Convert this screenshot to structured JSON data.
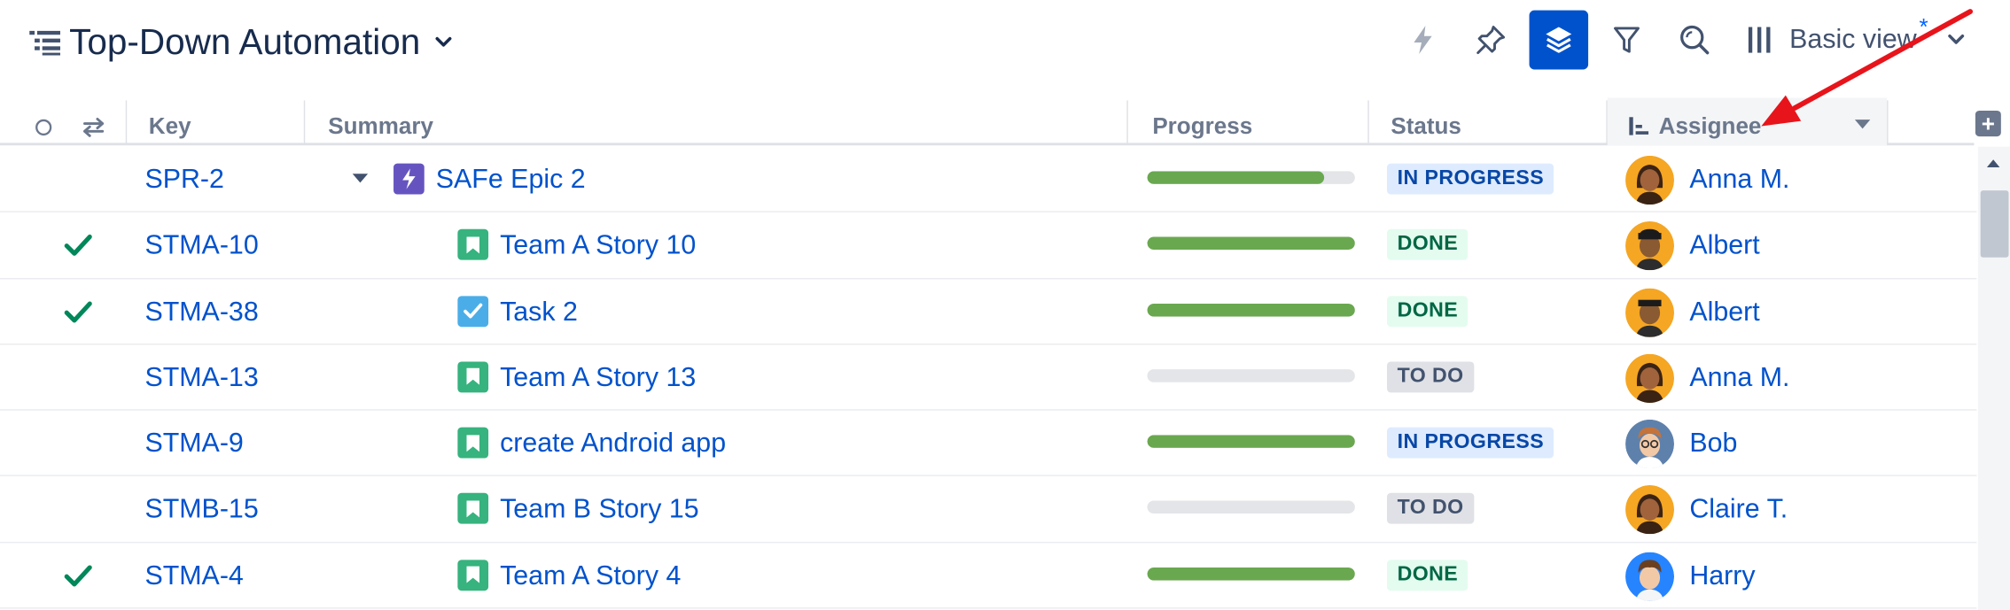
{
  "header": {
    "title": "Top-Down Automation",
    "view_label": "Basic view",
    "view_modified_mark": "*"
  },
  "columns": {
    "key": "Key",
    "summary": "Summary",
    "progress": "Progress",
    "status": "Status",
    "assignee": "Assignee"
  },
  "rows": [
    {
      "check": false,
      "key": "SPR-2",
      "summary": "SAFe Epic 2",
      "type": "epic-icon",
      "progress": 0.85,
      "status": "IN PROGRESS",
      "status_kind": "progress",
      "assignee": "Anna M.",
      "avatar": "anna"
    },
    {
      "check": true,
      "key": "STMA-10",
      "summary": "Team A Story 10",
      "type": "story-icon",
      "progress": 1.0,
      "status": "DONE",
      "status_kind": "done",
      "assignee": "Albert",
      "avatar": "albert"
    },
    {
      "check": true,
      "key": "STMA-38",
      "summary": "Task 2",
      "type": "task-icon",
      "progress": 1.0,
      "status": "DONE",
      "status_kind": "done",
      "assignee": "Albert",
      "avatar": "albert"
    },
    {
      "check": false,
      "key": "STMA-13",
      "summary": "Team A Story 13",
      "type": "story-icon",
      "progress": 0,
      "status": "TO DO",
      "status_kind": "todo",
      "assignee": "Anna M.",
      "avatar": "anna"
    },
    {
      "check": false,
      "key": "STMA-9",
      "summary": "create Android app",
      "type": "story-icon",
      "progress": 1.0,
      "status": "IN PROGRESS",
      "status_kind": "progress",
      "assignee": "Bob",
      "avatar": "bob"
    },
    {
      "check": false,
      "key": "STMB-15",
      "summary": "Team B Story 15",
      "type": "story-icon",
      "progress": 0,
      "status": "TO DO",
      "status_kind": "todo",
      "assignee": "Claire T.",
      "avatar": "claire"
    },
    {
      "check": true,
      "key": "STMA-4",
      "summary": "Team A Story 4",
      "type": "story-icon",
      "progress": 1.0,
      "status": "DONE",
      "status_kind": "done",
      "assignee": "Harry",
      "avatar": "harry"
    }
  ],
  "colors": {
    "accent": "#0052cc",
    "progress_fill": "#6aa84f",
    "annotation_arrow": "#e8141b"
  }
}
